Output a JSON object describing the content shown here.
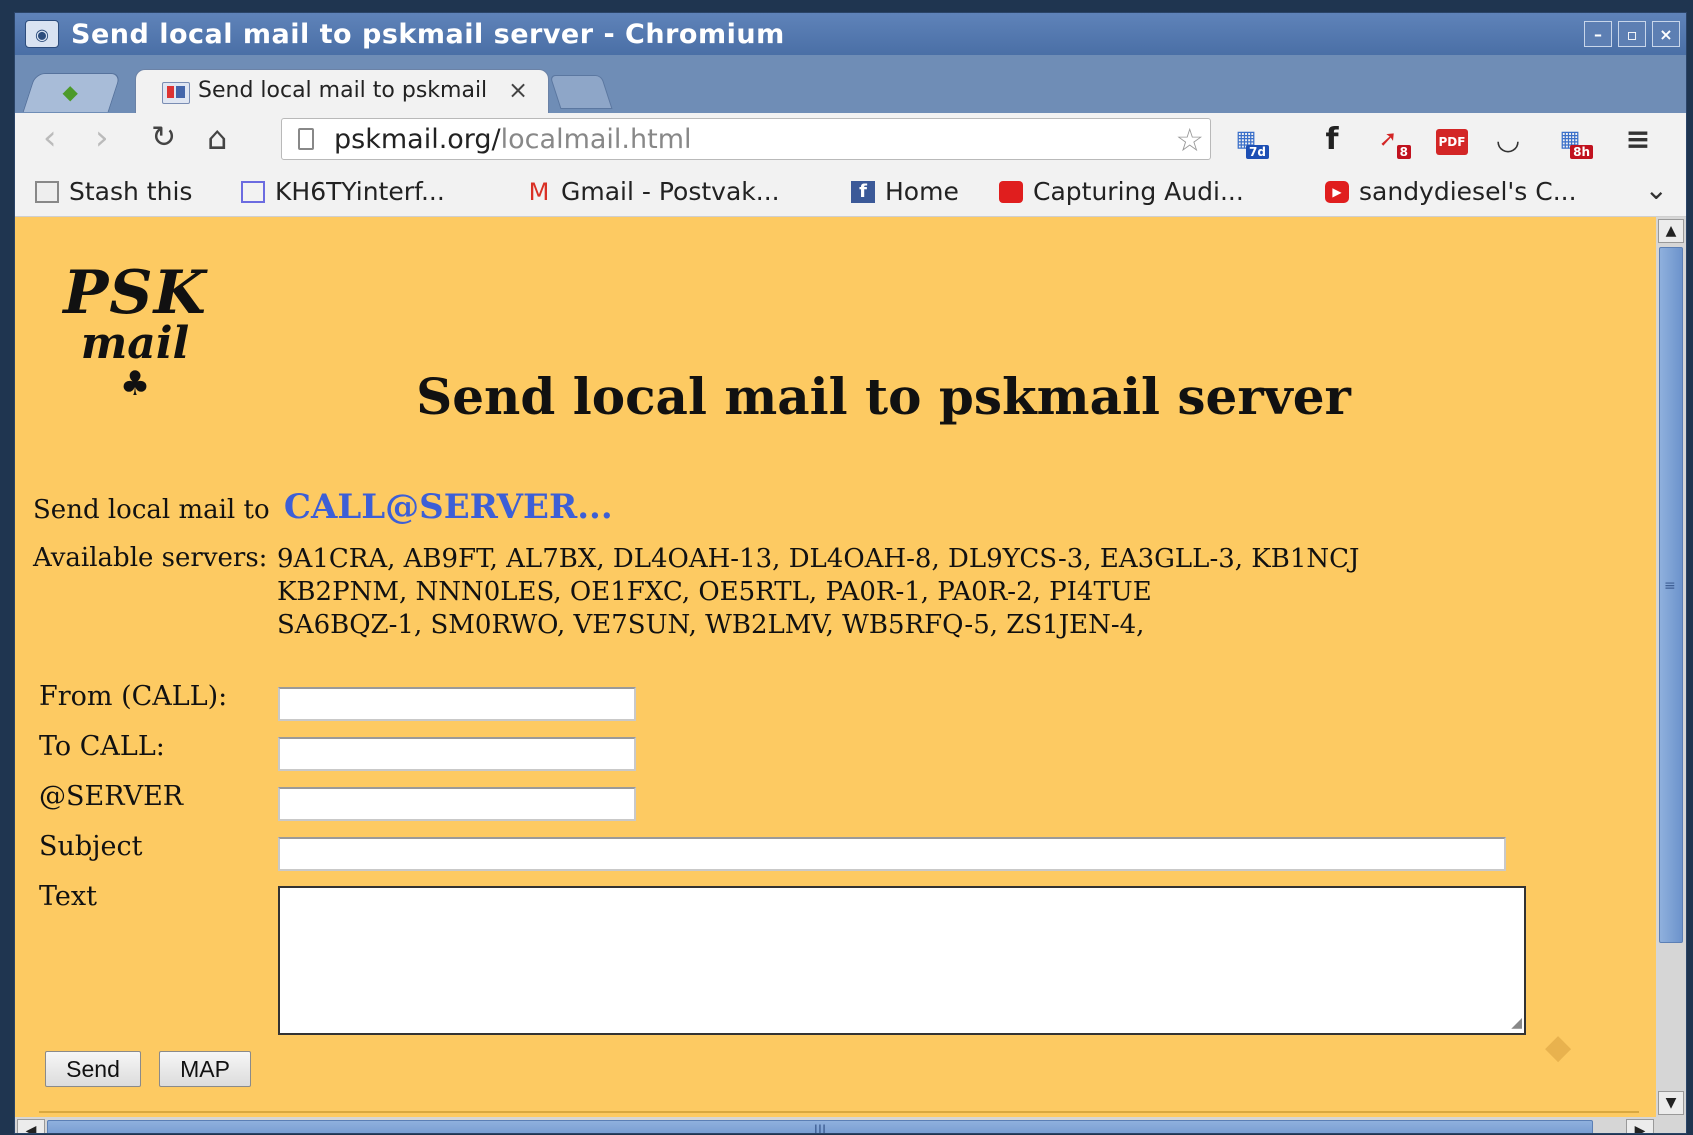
{
  "window": {
    "title": "Send local mail to pskmail server - Chromium",
    "controls": {
      "minimize": "–",
      "maximize": "▫",
      "close": "×"
    }
  },
  "tabs": {
    "active_label": "Send local mail to pskmail",
    "close": "×"
  },
  "toolbar": {
    "back": "‹",
    "forward": "›",
    "reload": "↻",
    "home": "⌂",
    "url_host": "pskmail.org/",
    "url_path": "localmail.html",
    "star": "☆",
    "extensions": [
      {
        "name": "calendar-ext-icon",
        "badge": "7d"
      },
      {
        "name": "facebook-icon",
        "badge": ""
      },
      {
        "name": "notify-ext-icon",
        "badge": "8"
      },
      {
        "name": "pdf-icon",
        "badge": ""
      },
      {
        "name": "pocket-icon",
        "badge": ""
      },
      {
        "name": "calendar-ext-icon-2",
        "badge": "8h"
      }
    ],
    "menu": "≡"
  },
  "bookmarks": [
    "Stash this",
    "KH6TYinterf...",
    "Gmail - Postvak...",
    "Home",
    "Capturing Audi...",
    "sandydiesel's C..."
  ],
  "page": {
    "logo": {
      "line1": "PSK",
      "line2": "mail",
      "line3": "♣"
    },
    "title": "Send local mail to pskmail server",
    "send_to_label": "Send local mail to",
    "send_to_link": "CALL@SERVER...",
    "servers_label": "Available servers:",
    "servers": [
      "9A1CRA, AB9FT, AL7BX, DL4OAH-13, DL4OAH-8, DL9YCS-3, EA3GLL-3, KB1NCJ",
      "KB2PNM, NNN0LES, OE1FXC, OE5RTL, PA0R-1, PA0R-2, PI4TUE",
      "SA6BQZ-1, SM0RWO, VE7SUN, WB2LMV, WB5RFQ-5, ZS1JEN-4,"
    ],
    "form": {
      "from_label": "From (CALL):",
      "to_label": "To CALL:",
      "server_label": "@SERVER",
      "subject_label": "Subject",
      "text_label": "Text",
      "from_value": "",
      "to_value": "",
      "server_value": "",
      "subject_value": "",
      "text_value": ""
    },
    "send_button": "Send",
    "map_button": "MAP"
  }
}
